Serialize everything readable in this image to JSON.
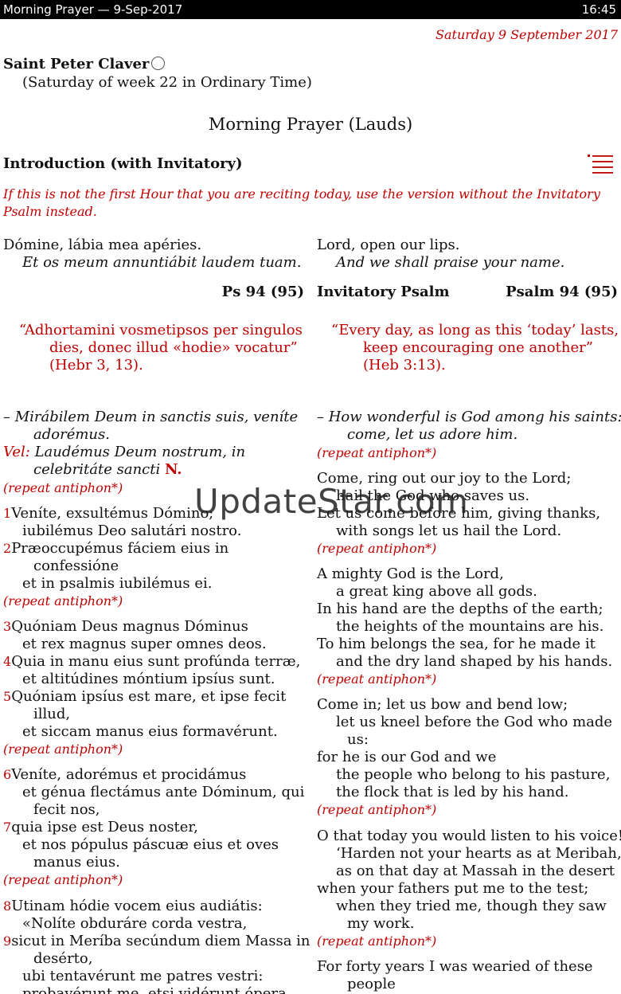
{
  "status_bar": {
    "title": "Morning Prayer — 9-Sep-2017",
    "time": "16:45"
  },
  "date": "Saturday 9 September 2017",
  "saint": "Saint Peter Claver",
  "subtitle": "(Saturday of week 22 in Ordinary Time)",
  "hour_title": "Morning Prayer (Lauds)",
  "section_title": "Introduction (with Invitatory)",
  "note": "If this is not the first Hour that you are reciting today, use the version without the Invitatory Psalm instead.",
  "latin": {
    "opening1": "Dómine, lábia mea apéries.",
    "opening2": "Et os meum annuntiábit laudem tuam.",
    "ps_ref": "Ps 94 (95)",
    "ant1": "“Adhortamini vosmetipsos per singulos",
    "ant2": "dies, donec illud «hodie» vocatur”",
    "ant3": "(Hebr 3, 13).",
    "a1": "– Mirábilem Deum in sanctis suis, veníte",
    "a2": "adorémus.",
    "vel": "Vel:",
    "a3": "Laudémus Deum nostrum, in",
    "a4": "celebritáte sancti",
    "a4n": "N.",
    "repeat": "(repeat antiphon*)",
    "v1": "Veníte, exsultémus Dómino;",
    "v1b": "iubilémus Deo salutári nostro.",
    "v2": "Præoccupémus fáciem eius in",
    "v2b": "confessióne",
    "v2c": "et in psalmis iubilémus ei.",
    "v3": "Quóniam Deus magnus Dóminus",
    "v3b": "et rex magnus super omnes deos.",
    "v4": "Quia in manu eius sunt profúnda terræ,",
    "v4b": "et altitúdines móntium ipsíus sunt.",
    "v5": "Quóniam ipsíus est mare, et ipse fecit",
    "v5b": "illud,",
    "v5c": "et siccam manus eius formavérunt.",
    "v6": "Veníte, adorémus et procidámus",
    "v6b": "et génua flectámus ante Dóminum, qui",
    "v6c": "fecit nos,",
    "v7": "quia ipse est Deus noster,",
    "v7b": "et nos pópulus páscuæ eius et oves",
    "v7c": "manus eius.",
    "v8": "Utinam hódie vocem eius audiátis:",
    "v8b": "«Nolíte obduráre corda vestra,",
    "v9": "sicut in Meríba secúndum diem Massa in",
    "v9b": "desérto,",
    "v9c": "ubi tentavérunt me patres vestri:",
    "v9d": "probavérunt me, etsi vidérunt ópera",
    "n1": "1",
    "n2": "2",
    "n3": "3",
    "n4": "4",
    "n5": "5",
    "n6": "6",
    "n7": "7",
    "n8": "8",
    "n9": "9"
  },
  "english": {
    "opening1": "Lord, open our lips.",
    "opening2": "And we shall praise your name.",
    "invitatory": "Invitatory Psalm",
    "ps_ref": "Psalm 94 (95)",
    "ant1": "“Every day, as long as this ‘today’ lasts,",
    "ant2": "keep encouraging one another”",
    "ant3": "(Heb 3:13).",
    "a1": "– How wonderful is God among his saints:",
    "a2": "come, let us adore him.",
    "repeat": "(repeat antiphon*)",
    "s1a": "Come, ring out our joy to the Lord;",
    "s1b": "hail the God who saves us.",
    "s1c": "Let us come before him, giving thanks,",
    "s1d": "with songs let us hail the Lord.",
    "s2a": "A mighty God is the Lord,",
    "s2b": "a great king above all gods.",
    "s2c": "In his hand are the depths of the earth;",
    "s2d": "the heights of the mountains are his.",
    "s2e": "To him belongs the sea, for he made it",
    "s2f": "and the dry land shaped by his hands.",
    "s3a": "Come in; let us bow and bend low;",
    "s3b": "let us kneel before the God who made",
    "s3c": "us:",
    "s3d": "for he is our God and we",
    "s3e": "the people who belong to his pasture,",
    "s3f": "the flock that is led by his hand.",
    "s4a": "O that today you would listen to his voice!",
    "s4b": "‘Harden not your hearts as at Meribah,",
    "s4c": "as on that day at Massah in the desert",
    "s4d": "when your fathers put me to the test;",
    "s4e": "when they tried me, though they saw",
    "s4f": "my work.",
    "s5a": "For forty years I was wearied of these",
    "s5b": "people"
  },
  "watermark": "UpdateStar.com",
  "colors": {
    "rubric": "#c00000",
    "statusbar": "#000000"
  },
  "icons": {
    "menu": "list-menu-icon",
    "favorite": "circle-icon"
  }
}
